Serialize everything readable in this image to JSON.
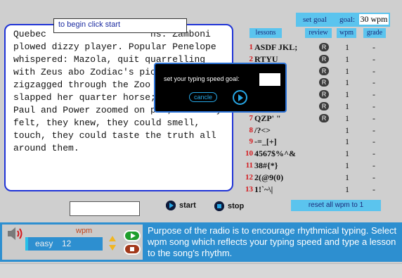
{
  "lesson_text": "Quebec                   ns. Zamboni plowed dizzy player. Popular Penelope whispered: Mazola, quit quarrelling with Zeus abo Zodiac's picture. Quick z zigzagged through the Zoo applauded and slapped her quarter horse; Zen, Quark, Paul and Power zoomed on pie; But they felt, they knew, they could smell, touch, they could taste the truth all around them.",
  "tooltip": "to begin click start",
  "goal": {
    "label": "set goal",
    "goal_word": "goal:",
    "value": "30 wpm"
  },
  "headers": {
    "lessons": "lessons",
    "review": "review",
    "wpm": "wpm",
    "grade": "grade"
  },
  "lessons": [
    {
      "num": "1",
      "text": "ASDF JKL;",
      "review": "R",
      "wpm": "1",
      "grade": "-"
    },
    {
      "num": "2",
      "text": "RTYU",
      "review": "R",
      "wpm": "1",
      "grade": "-"
    },
    {
      "num": "3",
      "text": "",
      "review": "R",
      "wpm": "1",
      "grade": "-"
    },
    {
      "num": "4",
      "text": "",
      "review": "R",
      "wpm": "1",
      "grade": "-"
    },
    {
      "num": "5",
      "text": "",
      "review": "R",
      "wpm": "1",
      "grade": "-"
    },
    {
      "num": "6",
      "text": "",
      "review": "R",
      "wpm": "1",
      "grade": "-"
    },
    {
      "num": "7",
      "text": "QZP' \"",
      "review": "R",
      "wpm": "1",
      "grade": "-"
    },
    {
      "num": "8",
      "text": "/?<>",
      "review": "",
      "wpm": "1",
      "grade": "-"
    },
    {
      "num": "9",
      "text": "-=_[+]",
      "review": "",
      "wpm": "1",
      "grade": "-"
    },
    {
      "num": "10",
      "text": "4567$%^&",
      "review": "",
      "wpm": "1",
      "grade": "-"
    },
    {
      "num": "11",
      "text": "38#{*}",
      "review": "",
      "wpm": "1",
      "grade": "-"
    },
    {
      "num": "12",
      "text": "2(@9(0)",
      "review": "",
      "wpm": "1",
      "grade": "-"
    },
    {
      "num": "13",
      "text": "1!`~\\|",
      "review": "",
      "wpm": "1",
      "grade": "-"
    }
  ],
  "dialog": {
    "prompt": "set your typing speed goal:",
    "cancel": "cancle"
  },
  "controls": {
    "start": "start",
    "stop": "stop",
    "reset": "reset all wpm to 1"
  },
  "radio": {
    "wpm_label": "wpm",
    "song_name": "easy",
    "song_wpm": "12",
    "description": "Purpose of the radio is to encourage rhythmical typing. Select wpm song which reflects your typing speed and type a lesson to the song's rhythm."
  },
  "colors": {
    "accent": "#5bc4ee",
    "panel_border": "#1f33d6",
    "radio_bg": "#2d8fd0",
    "lesson_num": "#d4181c"
  },
  "icons": {
    "speaker": "speaker-icon",
    "start": "play-circle-icon",
    "stop": "stop-square-icon"
  }
}
